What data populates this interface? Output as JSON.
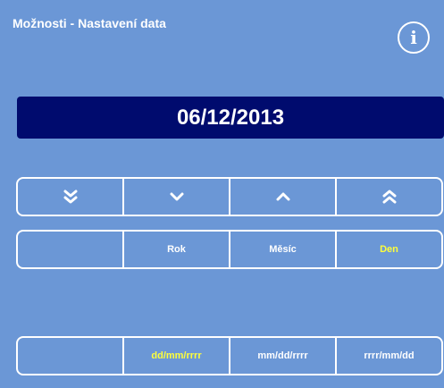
{
  "window": {
    "title": "Možnosti - Nastavení data"
  },
  "info_icon": {
    "glyph": "i",
    "icon": "info-icon"
  },
  "date": {
    "value": "06/12/2013"
  },
  "arrows": [
    {
      "icon": "double-chevron-down-icon"
    },
    {
      "icon": "chevron-down-icon"
    },
    {
      "icon": "chevron-up-icon"
    },
    {
      "icon": "double-chevron-up-icon"
    }
  ],
  "fields": {
    "year": "Rok",
    "month": "Měsíc",
    "day": "Den",
    "selected": "day"
  },
  "formats": {
    "dmy": "dd/mm/rrrr",
    "mdy": "mm/dd/rrrr",
    "ymd": "rrrr/mm/dd",
    "selected": "dmy"
  },
  "colors": {
    "background": "#6b97d6",
    "display_bg": "#000b6e",
    "text": "#ffffff",
    "highlight": "#ffff3a"
  }
}
